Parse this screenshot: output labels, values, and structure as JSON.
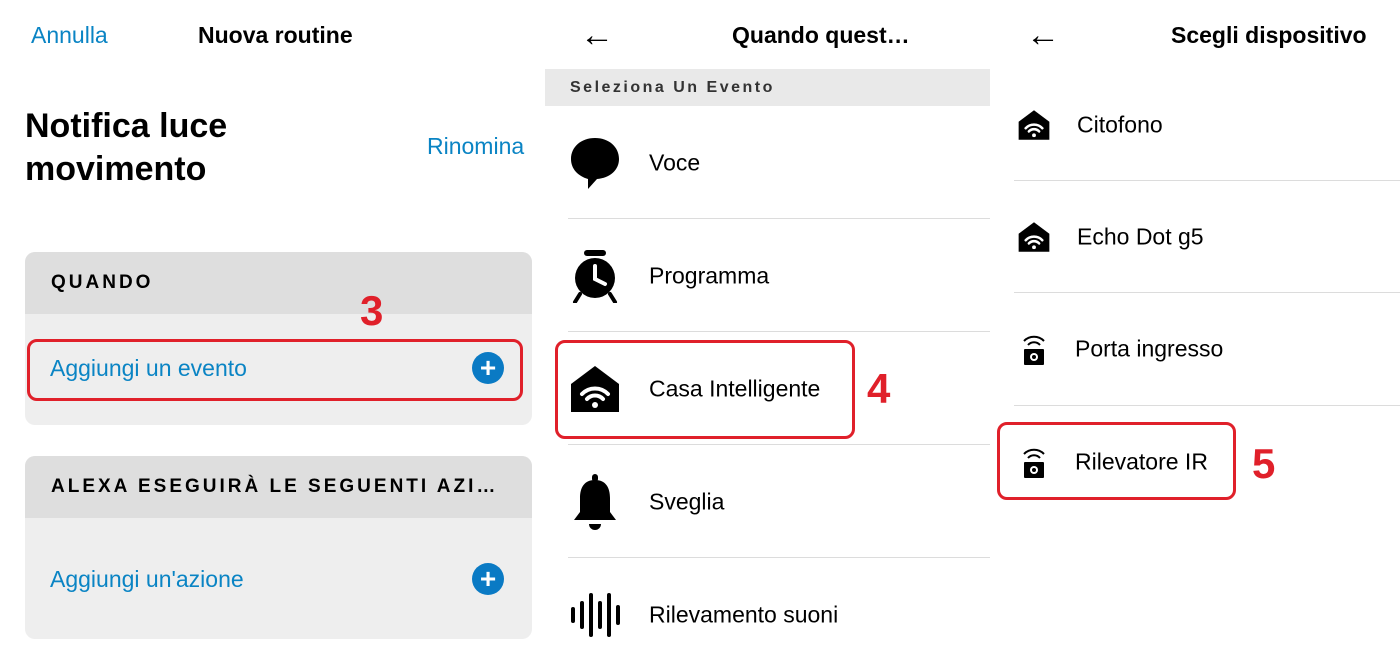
{
  "panel1": {
    "cancel_label": "Annulla",
    "title": "Nuova routine",
    "routine_name": "Notifica luce movimento",
    "rename_label": "Rinomina",
    "when_header": "QUANDO",
    "add_event_label": "Aggiungi un evento",
    "actions_header": "ALEXA ESEGUIRÀ LE SEGUENTI AZI…",
    "add_action_label": "Aggiungi un'azione",
    "step_number": "3"
  },
  "panel2": {
    "title": "Quando quest…",
    "section_label": "Seleziona Un Evento",
    "events": [
      {
        "label": "Voce",
        "icon": "speech-bubble-icon"
      },
      {
        "label": "Programma",
        "icon": "alarm-clock-icon"
      },
      {
        "label": "Casa Intelligente",
        "icon": "smart-home-icon"
      },
      {
        "label": "Sveglia",
        "icon": "bell-icon"
      },
      {
        "label": "Rilevamento suoni",
        "icon": "sound-wave-icon"
      }
    ],
    "step_number": "4"
  },
  "panel3": {
    "title": "Scegli dispositivo",
    "devices": [
      {
        "label": "Citofono",
        "icon": "smart-home-icon"
      },
      {
        "label": "Echo Dot g5",
        "icon": "smart-home-icon"
      },
      {
        "label": "Porta ingresso",
        "icon": "sensor-icon"
      },
      {
        "label": "Rilevatore IR",
        "icon": "sensor-icon"
      }
    ],
    "step_number": "5"
  },
  "colors": {
    "link_blue": "#0a84c4",
    "highlight_red": "#e0202a",
    "card_bg": "#eeeeee",
    "card_header_bg": "#dedede"
  }
}
